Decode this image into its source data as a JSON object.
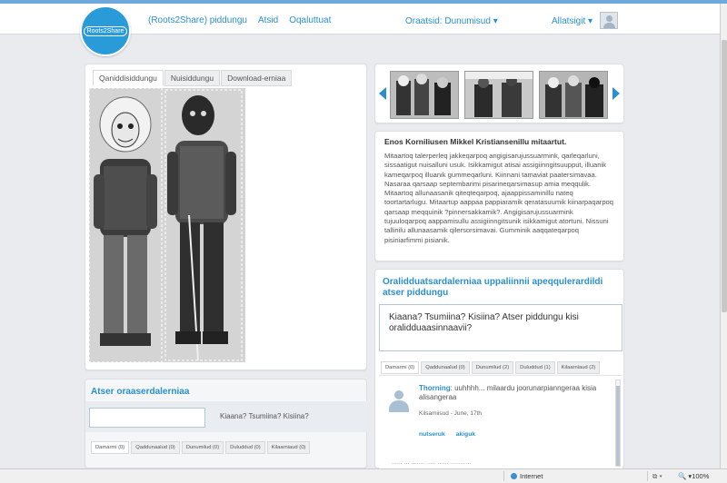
{
  "logo": {
    "text": "Roots2Share"
  },
  "nav": {
    "items": [
      "(Roots2Share) piddungu",
      "Atsid",
      "Oqaluttuat"
    ]
  },
  "language": {
    "label": "Oraatsid: Dunumisud ▾"
  },
  "settings": {
    "label": "Allatsigit ▾"
  },
  "image_tabs": [
    "Qaniddisiddungu",
    "Nuisiddungu",
    "Download-erniaa"
  ],
  "story": {
    "title": "Enos Korniliusen Mikkel Kristiansenillu mitaartut.",
    "body": "Mitaartoq talerperleq jakkeqarpoq angigisarujussuarmink, qarleqarluni, sissaatigut nuisalluni usuk. Isikkamigut atisai assigiinngitsuupput, illuanik kameqarpoq illuanik gummeqarluni. Kiinnani tamaviat paatersimavaa. Nasaraa qarsaap septembarimi pisarineqarsimasup amia meqqulik. Mitaartoq allunaasanik qiteqteqarpoq, ajaappissaminillu nateq toortartarlugu. Mitaartup aappaa pappiaramik qeratasuumik kiinarpaqarpoq qarsaap meqquinik ?pinnersakkamik?. Angigisarujussuarmink tujuuloqarpoq aappamisullu assigiinngitsunik isikkamigut atortuni. Nissuni tallinilu allunaasamik qilersorsimavai. Gumminik aaqqateqarpoq pisiniarfimmi pisianik."
  },
  "right_comments": {
    "title": "Oralidduatsardalerniaa uppaliinnii apeqqulerardildi atser piddungu",
    "question": "Kiaana? Tsumiina? Kisiina? Atser piddungu kisi oralidduaasinnaavii?",
    "tabs": [
      "Damarmi (0)",
      "Qaddunaalud (0)",
      "Dunumilud (2)",
      "Duluddud (1)",
      "Kilaarniaud (2)"
    ]
  },
  "comment": {
    "author": "Thorning",
    "text": ": uuhhhh... milaardu joorunarpianngeraa kisia alisangeraa",
    "meta": "Kilsamiisud - June, 17th",
    "actions": [
      "nutseruk",
      "akiguk"
    ],
    "next_preview": "...... ... ........ ..... ...... ............"
  },
  "left_comments": {
    "title": "Atser oraaserdalerniaa",
    "prompt": "Kiaana? Tsumiina? Kisiina?",
    "tabs": [
      "Damarmi (0)",
      "Qaddunaalud (0)",
      "Dunumilud (0)",
      "Duluddud (0)",
      "Kilaarniaud (0)"
    ]
  },
  "statusbar": {
    "zone": "Internet",
    "zoom": "100%",
    "security": "⧉ ▾",
    "zoom_icon": "🔍 ▾"
  },
  "colors": {
    "accent": "#2a8fcf",
    "logo": "#2a9bd9"
  }
}
